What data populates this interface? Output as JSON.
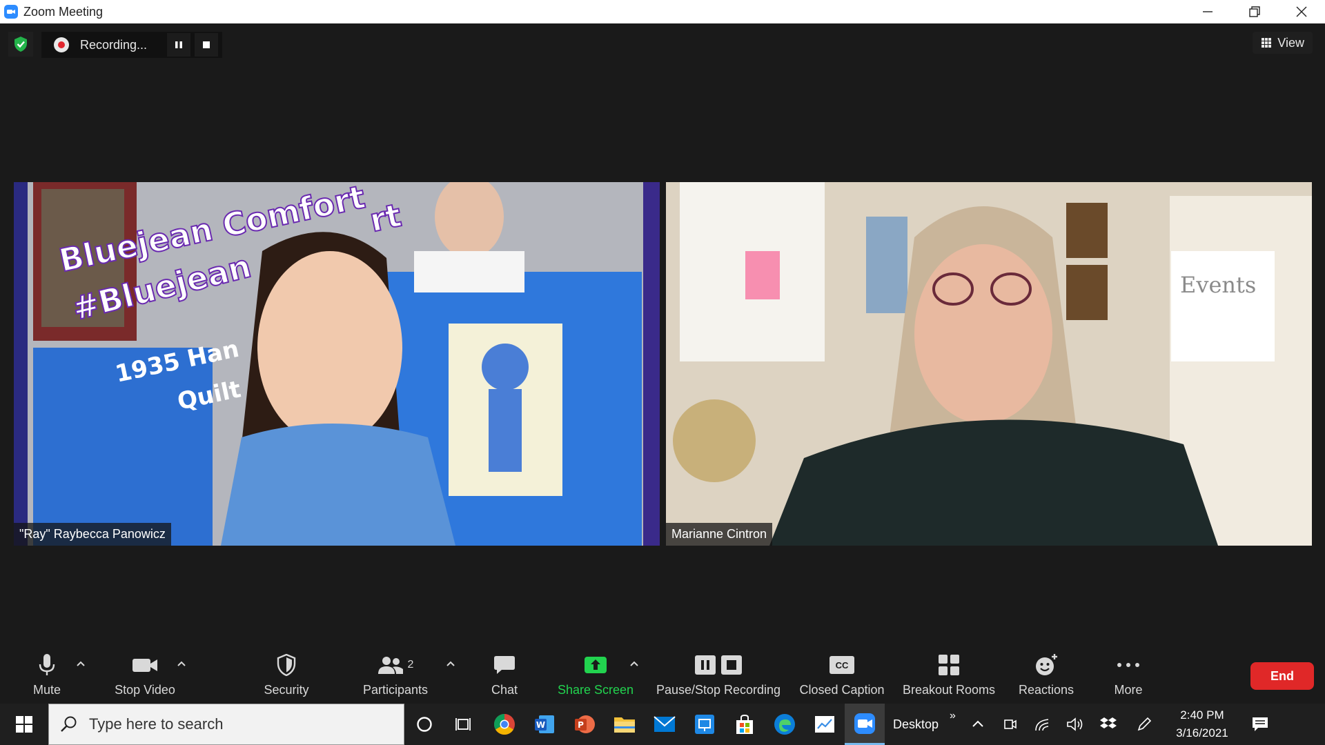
{
  "window": {
    "title": "Zoom Meeting"
  },
  "recording": {
    "label": "Recording..."
  },
  "view": {
    "label": "View"
  },
  "participants_tiles": [
    {
      "name": "\"Ray\" Raybecca Panowicz",
      "overlay": [
        "Bluejean Comfort",
        "#Bluejean",
        "rt",
        "1935 Han",
        "Quilt"
      ]
    },
    {
      "name": "Marianne Cintron",
      "overlay": [
        "Events"
      ]
    }
  ],
  "toolbar": {
    "mute": "Mute",
    "stop_video": "Stop Video",
    "security": "Security",
    "participants": "Participants",
    "participants_count": "2",
    "chat": "Chat",
    "share_screen": "Share Screen",
    "pause_stop_recording": "Pause/Stop Recording",
    "closed_caption": "Closed Caption",
    "cc_badge": "CC",
    "breakout_rooms": "Breakout Rooms",
    "reactions": "Reactions",
    "more": "More",
    "end": "End"
  },
  "taskbar": {
    "search_placeholder": "Type here to search",
    "desktop_label": "Desktop",
    "time": "2:40 PM",
    "date": "3/16/2021"
  },
  "colors": {
    "accent_blue": "#2d8cff",
    "share_green": "#22d34f",
    "end_red": "#e02828",
    "record_red": "#e0262e"
  }
}
